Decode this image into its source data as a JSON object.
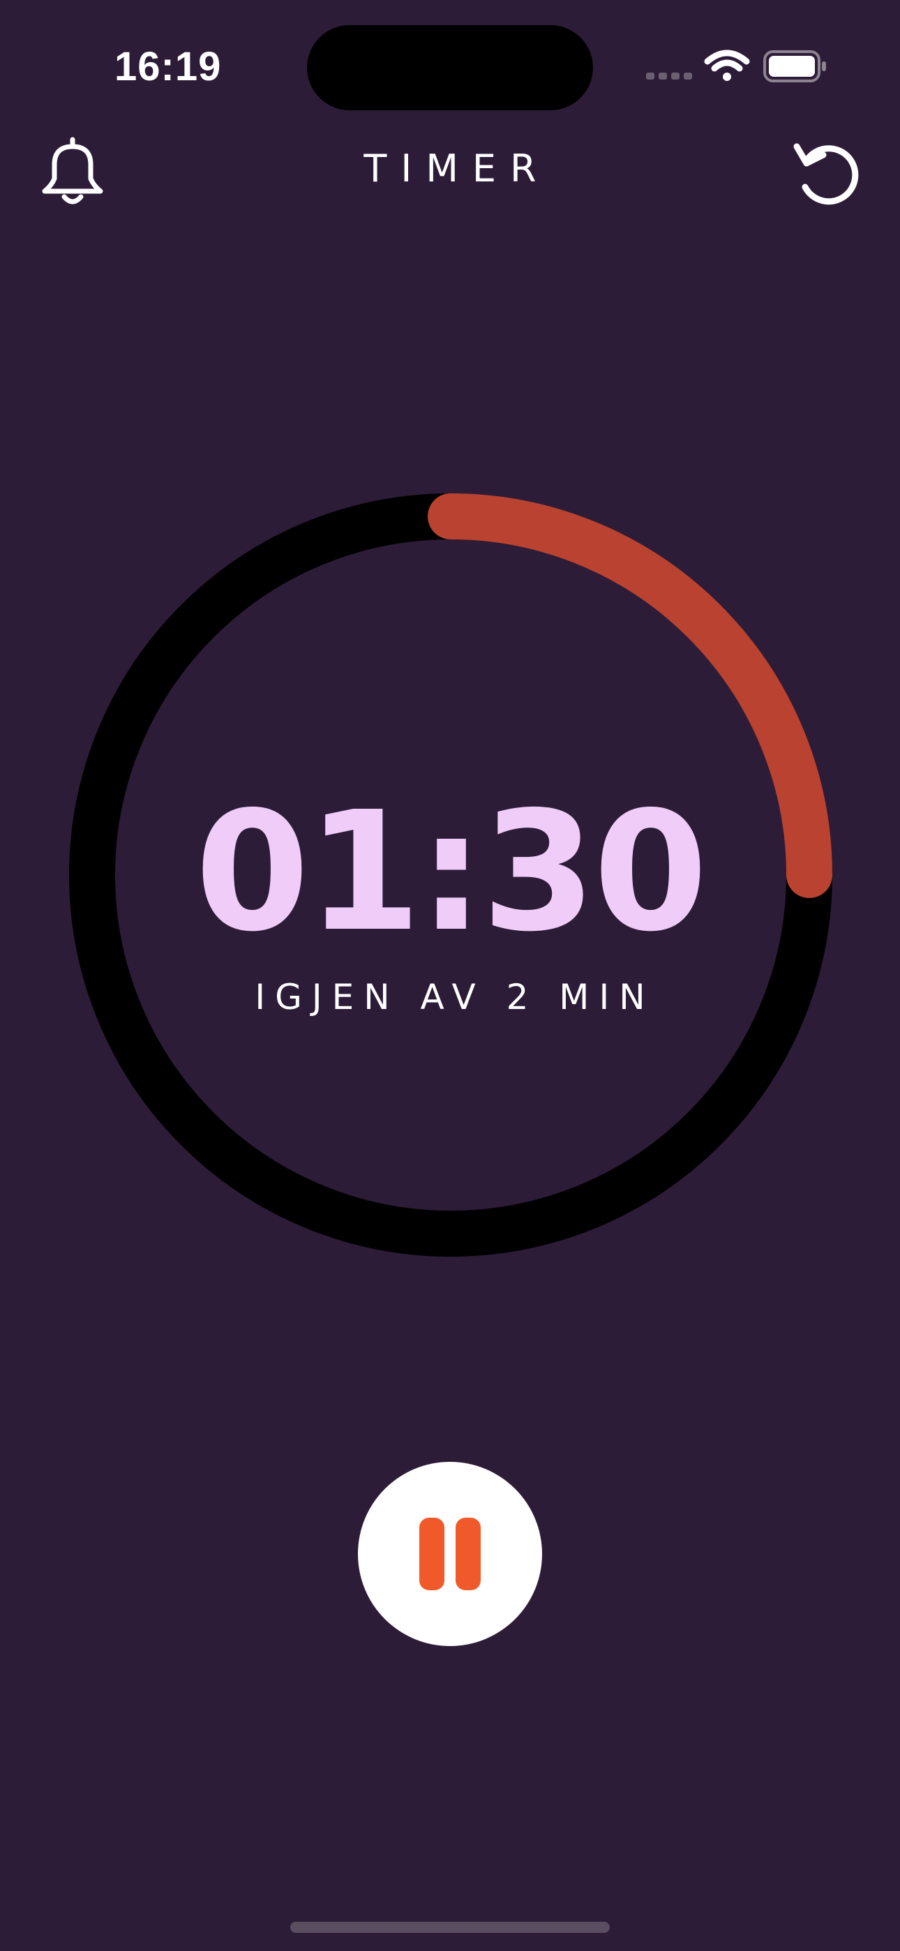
{
  "status_bar": {
    "time": "16:19",
    "wifi_icon": "wifi-icon",
    "battery_icon": "battery-icon",
    "signal_icon": "cellular-signal-icon"
  },
  "header": {
    "title": "TIMER",
    "left_icon": "bell-icon",
    "right_icon": "reset-icon"
  },
  "timer": {
    "remaining": "01:30",
    "subtitle": "IGJEN AV 2 MIN",
    "progress_elapsed_fraction": 0.25
  },
  "controls": {
    "pause_icon": "pause-icon"
  },
  "colors": {
    "background": "#2d1c38",
    "ring_track": "#000000",
    "ring_progress": "#b94330",
    "time_text": "#efcdf8",
    "pause_icon": "#f05a2a",
    "pause_button_bg": "#ffffff"
  }
}
